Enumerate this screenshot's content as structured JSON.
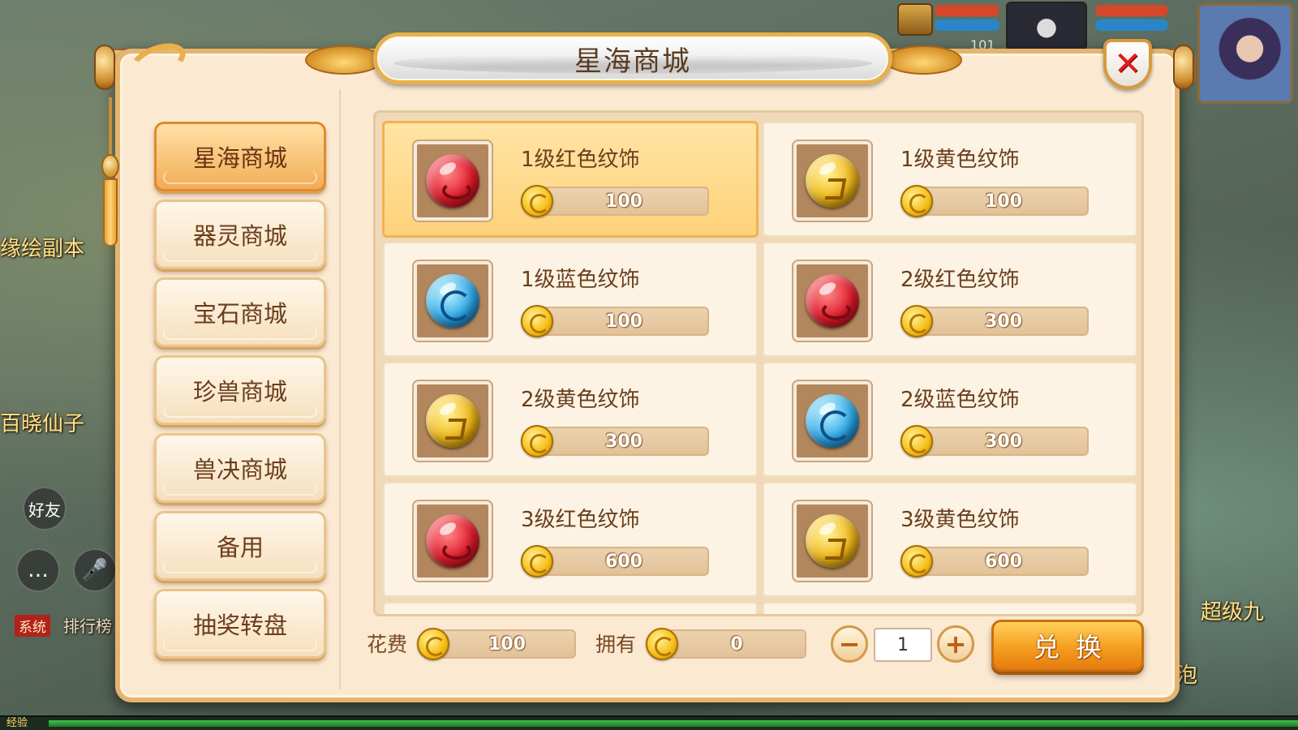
{
  "window": {
    "title": "星海商城",
    "close_label": "✕"
  },
  "nav": {
    "items": [
      {
        "label": "星海商城",
        "active": true
      },
      {
        "label": "器灵商城",
        "active": false
      },
      {
        "label": "宝石商城",
        "active": false
      },
      {
        "label": "珍兽商城",
        "active": false
      },
      {
        "label": "兽决商城",
        "active": false
      },
      {
        "label": "备用",
        "active": false
      },
      {
        "label": "抽奖转盘",
        "active": false
      }
    ]
  },
  "shop": {
    "items": [
      {
        "name": "1级红色纹饰",
        "price": "100",
        "gem": "red-gem-icon",
        "selected": true
      },
      {
        "name": "1级黄色纹饰",
        "price": "100",
        "gem": "yellow-gem-icon",
        "selected": false
      },
      {
        "name": "1级蓝色纹饰",
        "price": "100",
        "gem": "blue-gem-icon",
        "selected": false
      },
      {
        "name": "2级红色纹饰",
        "price": "300",
        "gem": "red-gem-icon",
        "selected": false
      },
      {
        "name": "2级黄色纹饰",
        "price": "300",
        "gem": "yellow-gem-icon",
        "selected": false
      },
      {
        "name": "2级蓝色纹饰",
        "price": "300",
        "gem": "blue-gem-icon",
        "selected": false
      },
      {
        "name": "3级红色纹饰",
        "price": "600",
        "gem": "red-gem-icon",
        "selected": false
      },
      {
        "name": "3级黄色纹饰",
        "price": "600",
        "gem": "yellow-gem-icon",
        "selected": false
      }
    ]
  },
  "footer": {
    "cost_label": "花费",
    "cost_value": "100",
    "owned_label": "拥有",
    "owned_value": "0",
    "quantity": "1",
    "minus_label": "−",
    "plus_label": "+",
    "exchange_label": "兑换"
  },
  "scene": {
    "dungeon_label": "缘绘副本",
    "npc_label": "百晓仙子",
    "friends_label": "好友",
    "system_tag": "系统",
    "ranking_label": "排行榜",
    "super_label": "超级九",
    "bubble_label": "泡泡",
    "exp_label": "经验",
    "hud_level": "101"
  },
  "colors": {
    "accent_orange": "#f39a1c",
    "panel_bg": "#fbe9d2",
    "selected_card": "#ffd27a",
    "close_red": "#e11b1b"
  }
}
